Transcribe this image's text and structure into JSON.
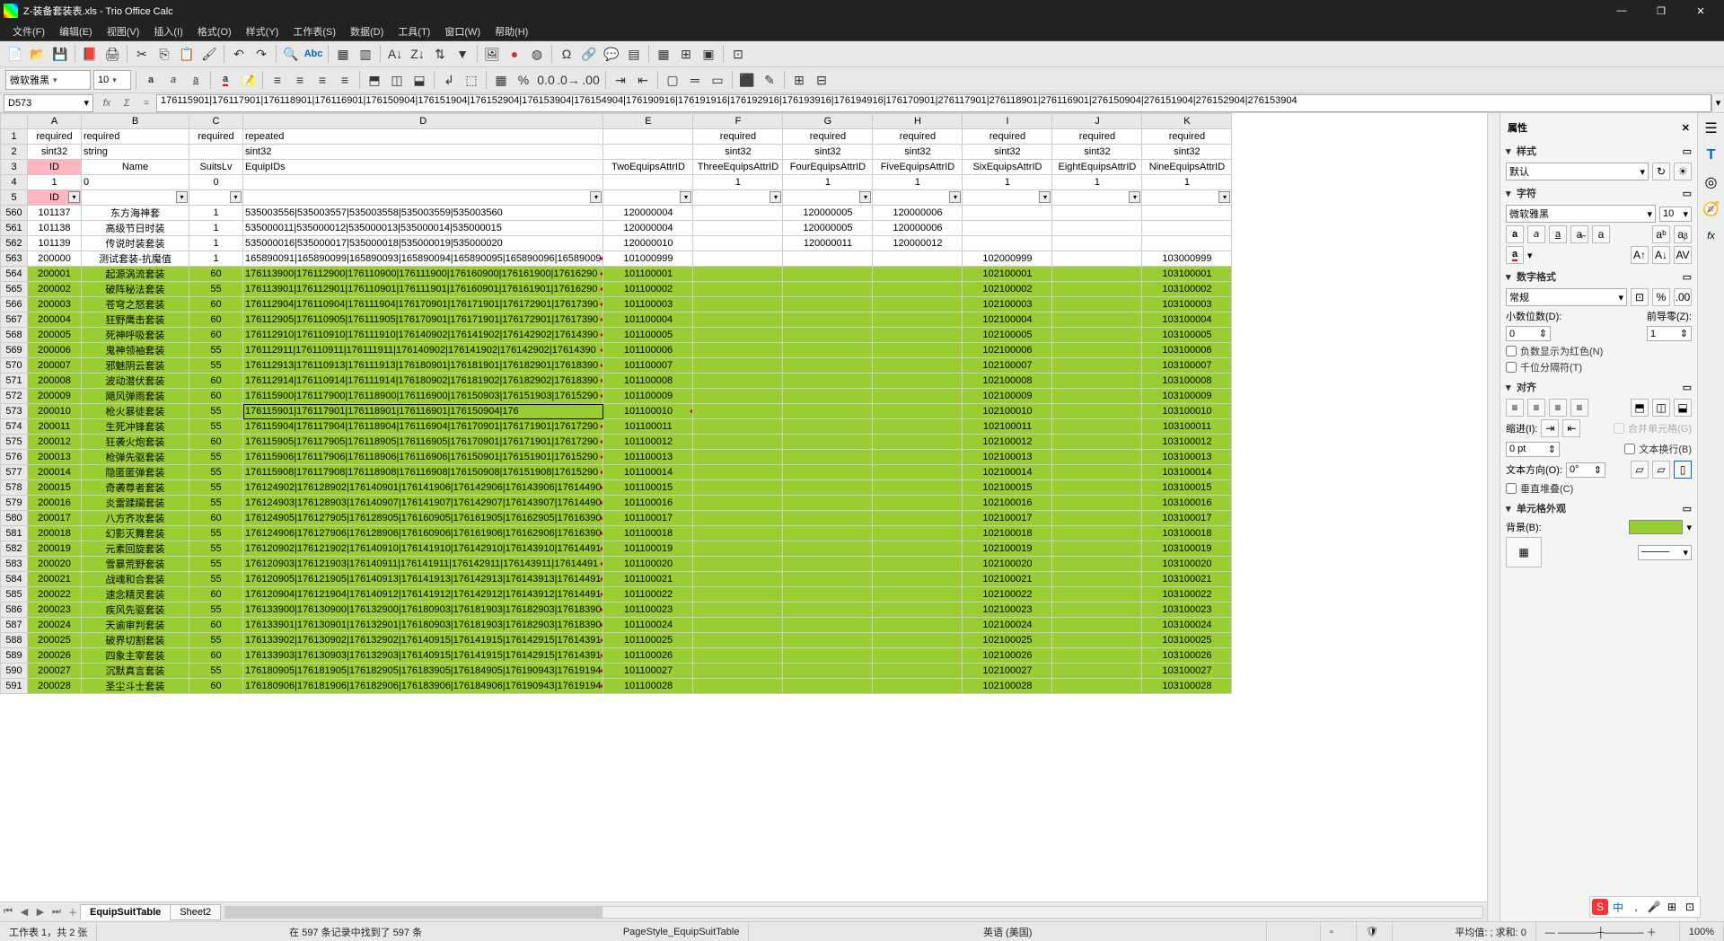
{
  "window": {
    "title": "Z-装备套装表.xls - Trio Office Calc"
  },
  "menu": [
    "文件(F)",
    "编辑(E)",
    "视图(V)",
    "插入(I)",
    "格式(O)",
    "样式(Y)",
    "工作表(S)",
    "数据(D)",
    "工具(T)",
    "窗口(W)",
    "帮助(H)"
  ],
  "font": {
    "name": "微软雅黑",
    "size": "10"
  },
  "cellref": "D573",
  "formula": "176115901|176117901|176118901|176116901|176150904|176151904|176152904|176153904|176154904|176190916|176191916|176192916|176193916|176194916|176170901|276117901|276118901|276116901|276150904|276151904|276152904|276153904",
  "columns": [
    "A",
    "B",
    "C",
    "D",
    "E",
    "F",
    "G",
    "H",
    "I",
    "J",
    "K"
  ],
  "headers": {
    "r1": [
      "required",
      "required",
      "required",
      "repeated",
      "",
      "required",
      "required",
      "required",
      "required",
      "required",
      "required"
    ],
    "r2": [
      "sint32",
      "string",
      "",
      "sint32",
      "",
      "sint32",
      "sint32",
      "sint32",
      "sint32",
      "sint32",
      "sint32"
    ],
    "r3": [
      "ID",
      "Name",
      "SuitsLv",
      "EquipIDs",
      "",
      "TwoEquipsAttrID",
      "ThreeEquipsAttrID",
      "FourEquipsAttrID",
      "FiveEquipsAttrID",
      "SixEquipsAttrID",
      "EightEquipsAttrID",
      "NineEquipsAttrID"
    ],
    "r4": [
      "1",
      "0",
      "0",
      "",
      "",
      "1",
      "1",
      "1",
      "1",
      "1",
      "1",
      "1"
    ],
    "r5": [
      "ID",
      "",
      "",
      "",
      "",
      "",
      "",
      "",
      "",
      "",
      "",
      ""
    ]
  },
  "rows": [
    {
      "n": 560,
      "a": "101137",
      "b": "东方海神套",
      "c": "1",
      "d": "535003556|535003557|535003558|535003559|535003560",
      "e": "120000004",
      "f": "",
      "g": "120000005",
      "h": "120000006",
      "i": "",
      "j": "",
      "k": ""
    },
    {
      "n": 561,
      "a": "101138",
      "b": "高级节日时装",
      "c": "1",
      "d": "535000011|535000012|535000013|535000014|535000015",
      "e": "120000004",
      "f": "",
      "g": "120000005",
      "h": "120000006",
      "i": "",
      "j": "",
      "k": ""
    },
    {
      "n": 562,
      "a": "101139",
      "b": "传说时装套装",
      "c": "1",
      "d": "535000016|535000017|535000018|535000019|535000020",
      "e": "120000010",
      "f": "",
      "g": "120000011",
      "h": "120000012",
      "i": "",
      "j": "",
      "k": ""
    },
    {
      "n": 563,
      "a": "200000",
      "b": "测试套装-抗魔值",
      "c": "1",
      "d": "165890091|165890099|165890093|165890094|165890095|165890096|16589009",
      "e": "101000999",
      "f": "",
      "g": "",
      "h": "",
      "i": "102000999",
      "j": "",
      "k": "103000999",
      "g2": true
    },
    {
      "n": 564,
      "a": "200001",
      "b": "起源涡流套装",
      "c": "60",
      "d": "176113900|176112900|176110900|176111900|176160900|176161900|17616290",
      "e": "101100001",
      "i": "102100001",
      "k": "103100001",
      "g2": true,
      "grn": true
    },
    {
      "n": 565,
      "a": "200002",
      "b": "破阵秘法套装",
      "c": "55",
      "d": "176113901|176112901|176110901|176111901|176160901|176161901|17616290",
      "e": "101100002",
      "i": "102100002",
      "k": "103100002",
      "g2": true,
      "grn": true
    },
    {
      "n": 566,
      "a": "200003",
      "b": "苍穹之怒套装",
      "c": "60",
      "d": "176112904|176110904|176111904|176170901|176171901|176172901|17617390",
      "e": "101100003",
      "i": "102100003",
      "k": "103100003",
      "g2": true,
      "grn": true
    },
    {
      "n": 567,
      "a": "200004",
      "b": "狂野鹰击套装",
      "c": "60",
      "d": "176112905|176110905|176111905|176170901|176171901|176172901|17617390",
      "e": "101100004",
      "i": "102100004",
      "k": "103100004",
      "g2": true,
      "grn": true
    },
    {
      "n": 568,
      "a": "200005",
      "b": "死神呼吸套装",
      "c": "60",
      "d": "176112910|176110910|176111910|176140902|176141902|176142902|17614390",
      "e": "101100005",
      "i": "102100005",
      "k": "103100005",
      "g2": true,
      "grn": true
    },
    {
      "n": 569,
      "a": "200006",
      "b": "鬼神领袖套装",
      "c": "55",
      "d": "176112911|176110911|176111911|176140902|176141902|176142902|17614390",
      "e": "101100006",
      "i": "102100006",
      "k": "103100006",
      "g2": true,
      "grn": true
    },
    {
      "n": 570,
      "a": "200007",
      "b": "邪魅阴云套装",
      "c": "55",
      "d": "176112913|176110913|176111913|176180901|176181901|176182901|17618390",
      "e": "101100007",
      "i": "102100007",
      "k": "103100007",
      "g2": true,
      "grn": true
    },
    {
      "n": 571,
      "a": "200008",
      "b": "波动潜伏套装",
      "c": "60",
      "d": "176112914|176110914|176111914|176180902|176181902|176182902|17618390",
      "e": "101100008",
      "i": "102100008",
      "k": "103100008",
      "g2": true,
      "grn": true
    },
    {
      "n": 572,
      "a": "200009",
      "b": "飓风弹雨套装",
      "c": "60",
      "d": "176115900|176117900|176118900|176116900|176150903|176151903|17615290",
      "e": "101100009",
      "i": "102100009",
      "k": "103100009",
      "g2": true,
      "grn": true
    },
    {
      "n": 573,
      "a": "200010",
      "b": "枪火暴徒套装",
      "c": "55",
      "d": "176115901|176117901|176118901|176116901|176150904|176",
      "d2": "151904|17615290",
      "e": "101100010",
      "i": "102100010",
      "k": "103100010",
      "g2": true,
      "grn": true,
      "sel": true
    },
    {
      "n": 574,
      "a": "200011",
      "b": "生死冲锋套装",
      "c": "55",
      "d": "176115904|176117904|176118904|176116904|176170901|176171901|17617290",
      "e": "101100011",
      "i": "102100011",
      "k": "103100011",
      "g2": true,
      "grn": true
    },
    {
      "n": 575,
      "a": "200012",
      "b": "狂袭火炮套装",
      "c": "60",
      "d": "176115905|176117905|176118905|176116905|176170901|176171901|17617290",
      "e": "101100012",
      "i": "102100012",
      "k": "103100012",
      "g2": true,
      "grn": true
    },
    {
      "n": 576,
      "a": "200013",
      "b": "枪弹先驱套装",
      "c": "55",
      "d": "176115906|176117906|176118906|176116906|176150901|176151901|17615290",
      "e": "101100013",
      "i": "102100013",
      "k": "103100013",
      "g2": true,
      "grn": true
    },
    {
      "n": 577,
      "a": "200014",
      "b": "隐匿匿弹套装",
      "c": "55",
      "d": "176115908|176117908|176118908|176116908|176150908|176151908|17615290",
      "e": "101100014",
      "i": "102100014",
      "k": "103100014",
      "g2": true,
      "grn": true
    },
    {
      "n": 578,
      "a": "200015",
      "b": "奇袭尊者套装",
      "c": "55",
      "d": "176124902|176128902|176140901|176141906|176142906|176143906|17614490",
      "e": "101100015",
      "i": "102100015",
      "k": "103100015",
      "g2": true,
      "grn": true
    },
    {
      "n": 579,
      "a": "200016",
      "b": "炎雷蹂躏套装",
      "c": "55",
      "d": "176124903|176128903|176140907|176141907|176142907|176143907|17614490",
      "e": "101100016",
      "i": "102100016",
      "k": "103100016",
      "g2": true,
      "grn": true
    },
    {
      "n": 580,
      "a": "200017",
      "b": "八方齐攻套装",
      "c": "60",
      "d": "176124905|176127905|176128905|176160905|176161905|176162905|17616390",
      "e": "101100017",
      "i": "102100017",
      "k": "103100017",
      "g2": true,
      "grn": true
    },
    {
      "n": 581,
      "a": "200018",
      "b": "幻影灭舞套装",
      "c": "55",
      "d": "176124906|176127906|176128906|176160906|176161906|176162906|17616390",
      "e": "101100018",
      "i": "102100018",
      "k": "103100018",
      "g2": true,
      "grn": true
    },
    {
      "n": 582,
      "a": "200019",
      "b": "元素回旋套装",
      "c": "55",
      "d": "176120902|176121902|176140910|176141910|176142910|176143910|17614491",
      "e": "101100019",
      "i": "102100019",
      "k": "103100019",
      "g2": true,
      "grn": true
    },
    {
      "n": 583,
      "a": "200020",
      "b": "雪暴荒野套装",
      "c": "55",
      "d": "176120903|176121903|176140911|176141911|176142911|176143911|17614491",
      "e": "101100020",
      "i": "102100020",
      "k": "103100020",
      "g2": true,
      "grn": true
    },
    {
      "n": 584,
      "a": "200021",
      "b": "战魂和合套装",
      "c": "55",
      "d": "176120905|176121905|176140913|176141913|176142913|176143913|17614491",
      "e": "101100021",
      "i": "102100021",
      "k": "103100021",
      "g2": true,
      "grn": true
    },
    {
      "n": 585,
      "a": "200022",
      "b": "速念精灵套装",
      "c": "60",
      "d": "176120904|176121904|176140912|176141912|176142912|176143912|17614491",
      "e": "101100022",
      "i": "102100022",
      "k": "103100022",
      "g2": true,
      "grn": true
    },
    {
      "n": 586,
      "a": "200023",
      "b": "疾风先驱套装",
      "c": "55",
      "d": "176133900|176130900|176132900|176180903|176181903|176182903|17618390",
      "e": "101100023",
      "i": "102100023",
      "k": "103100023",
      "g2": true,
      "grn": true
    },
    {
      "n": 587,
      "a": "200024",
      "b": "天谕审判套装",
      "c": "60",
      "d": "176133901|176130901|176132901|176180903|176181903|176182903|17618390",
      "e": "101100024",
      "i": "102100024",
      "k": "103100024",
      "g2": true,
      "grn": true
    },
    {
      "n": 588,
      "a": "200025",
      "b": "破界切割套装",
      "c": "55",
      "d": "176133902|176130902|176132902|176140915|176141915|176142915|17614391",
      "e": "101100025",
      "i": "102100025",
      "k": "103100025",
      "g2": true,
      "grn": true
    },
    {
      "n": 589,
      "a": "200026",
      "b": "四象主宰套装",
      "c": "60",
      "d": "176133903|176130903|176132903|176140915|176141915|176142915|17614391",
      "e": "101100026",
      "i": "102100026",
      "k": "103100026",
      "g2": true,
      "grn": true
    },
    {
      "n": 590,
      "a": "200027",
      "b": "沉默真言套装",
      "c": "55",
      "d": "176180905|176181905|176182905|176183905|176184905|176190943|17619194",
      "e": "101100027",
      "i": "102100027",
      "k": "103100027",
      "g2": true,
      "grn": true
    },
    {
      "n": 591,
      "a": "200028",
      "b": "圣尘斗士套装",
      "c": "60",
      "d": "176180906|176181906|176182906|176183906|176184906|176190943|17619194",
      "e": "101100028",
      "i": "102100028",
      "k": "103100028",
      "g2": true,
      "grn": true
    }
  ],
  "tabs": {
    "active": "EquipSuitTable",
    "other": "Sheet2"
  },
  "status": {
    "sheet": "工作表 1，共 2 张",
    "filter": "在 597 条记录中找到了 597 条",
    "style": "PageStyle_EquipSuitTable",
    "lang": "英语 (美国)",
    "insert": "",
    "calc": "平均值: ; 求和: 0",
    "zoom": "100%"
  },
  "sidebar": {
    "title": "属性",
    "style": {
      "label": "样式",
      "value": "默认"
    },
    "char": {
      "label": "字符",
      "font": "微软雅黑",
      "size": "10"
    },
    "numfmt": {
      "label": "数字格式",
      "value": "常规",
      "dec": "小数位数(D):",
      "decv": "0",
      "lead": "前导零(Z):",
      "leadv": "1",
      "neg": "负数显示为红色(N)",
      "sep": "千位分隔符(T)"
    },
    "align": {
      "label": "对齐",
      "indent": "缩进(I):",
      "indentv": "0 pt",
      "merge": "合并单元格(G)",
      "wrap": "文本换行(B)",
      "textdir": "文本方向(O):",
      "dirv": "0°",
      "vert": "垂直堆叠(C)"
    },
    "appear": {
      "label": "单元格外观",
      "bg": "背景(B):"
    }
  }
}
